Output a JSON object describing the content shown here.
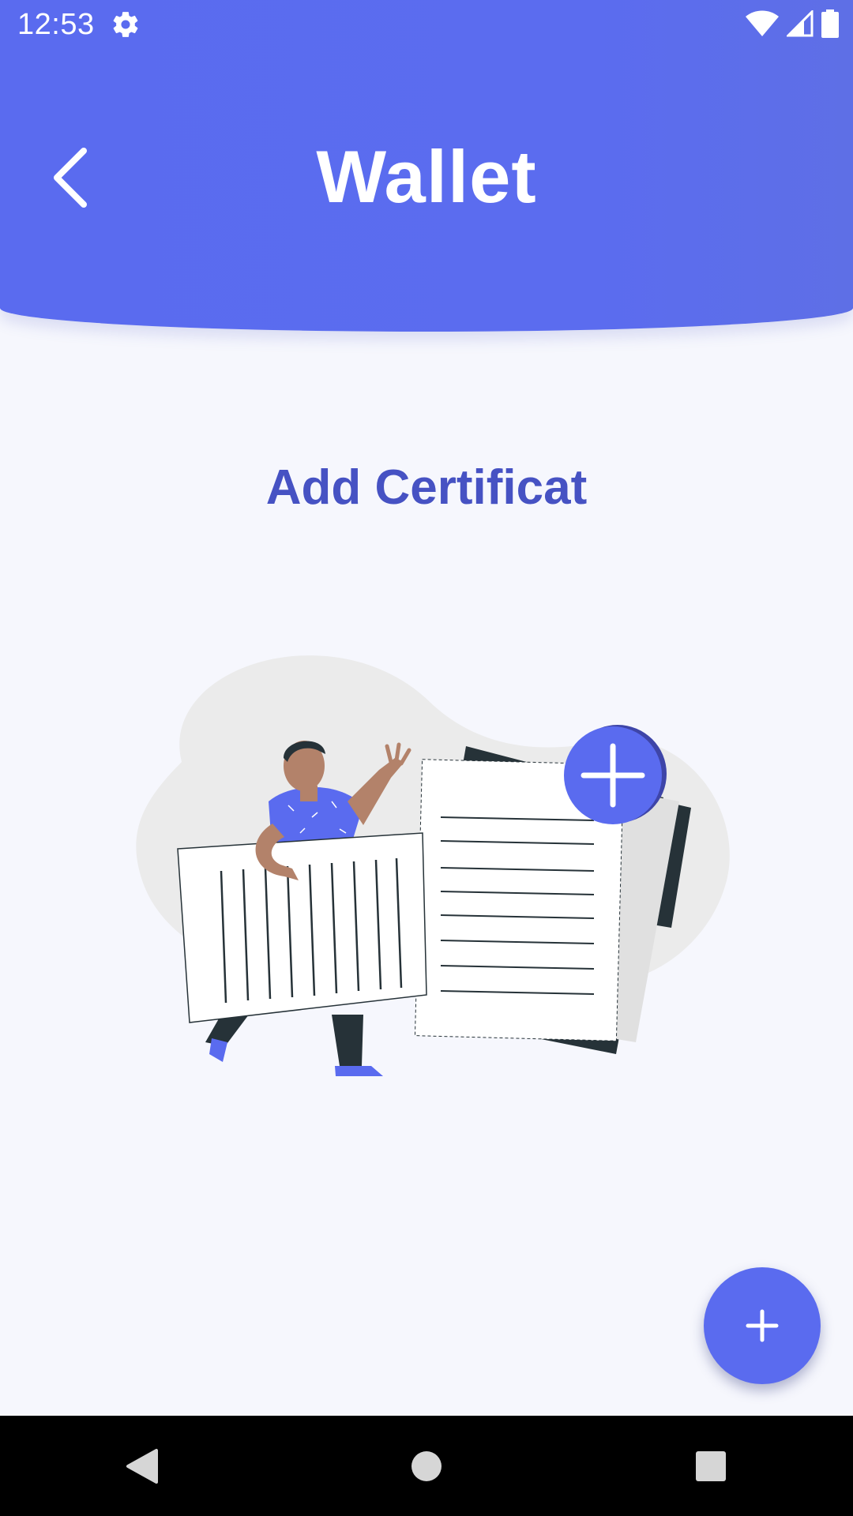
{
  "status_bar": {
    "time": "12:53",
    "icons": [
      "settings-icon",
      "wifi-icon",
      "cellular-signal-icon",
      "battery-icon"
    ]
  },
  "header": {
    "title": "Wallet",
    "back_icon": "chevron-left-icon"
  },
  "main": {
    "heading": "Add Certificat",
    "illustration": "person-holding-documents-illustration"
  },
  "fab": {
    "icon": "plus-icon"
  },
  "nav_bar": {
    "buttons": [
      "back-triangle-icon",
      "home-circle-icon",
      "recents-square-icon"
    ]
  },
  "colors": {
    "primary": "#5A6BEF",
    "heading": "#4652C3",
    "background": "#F6F7FD"
  }
}
